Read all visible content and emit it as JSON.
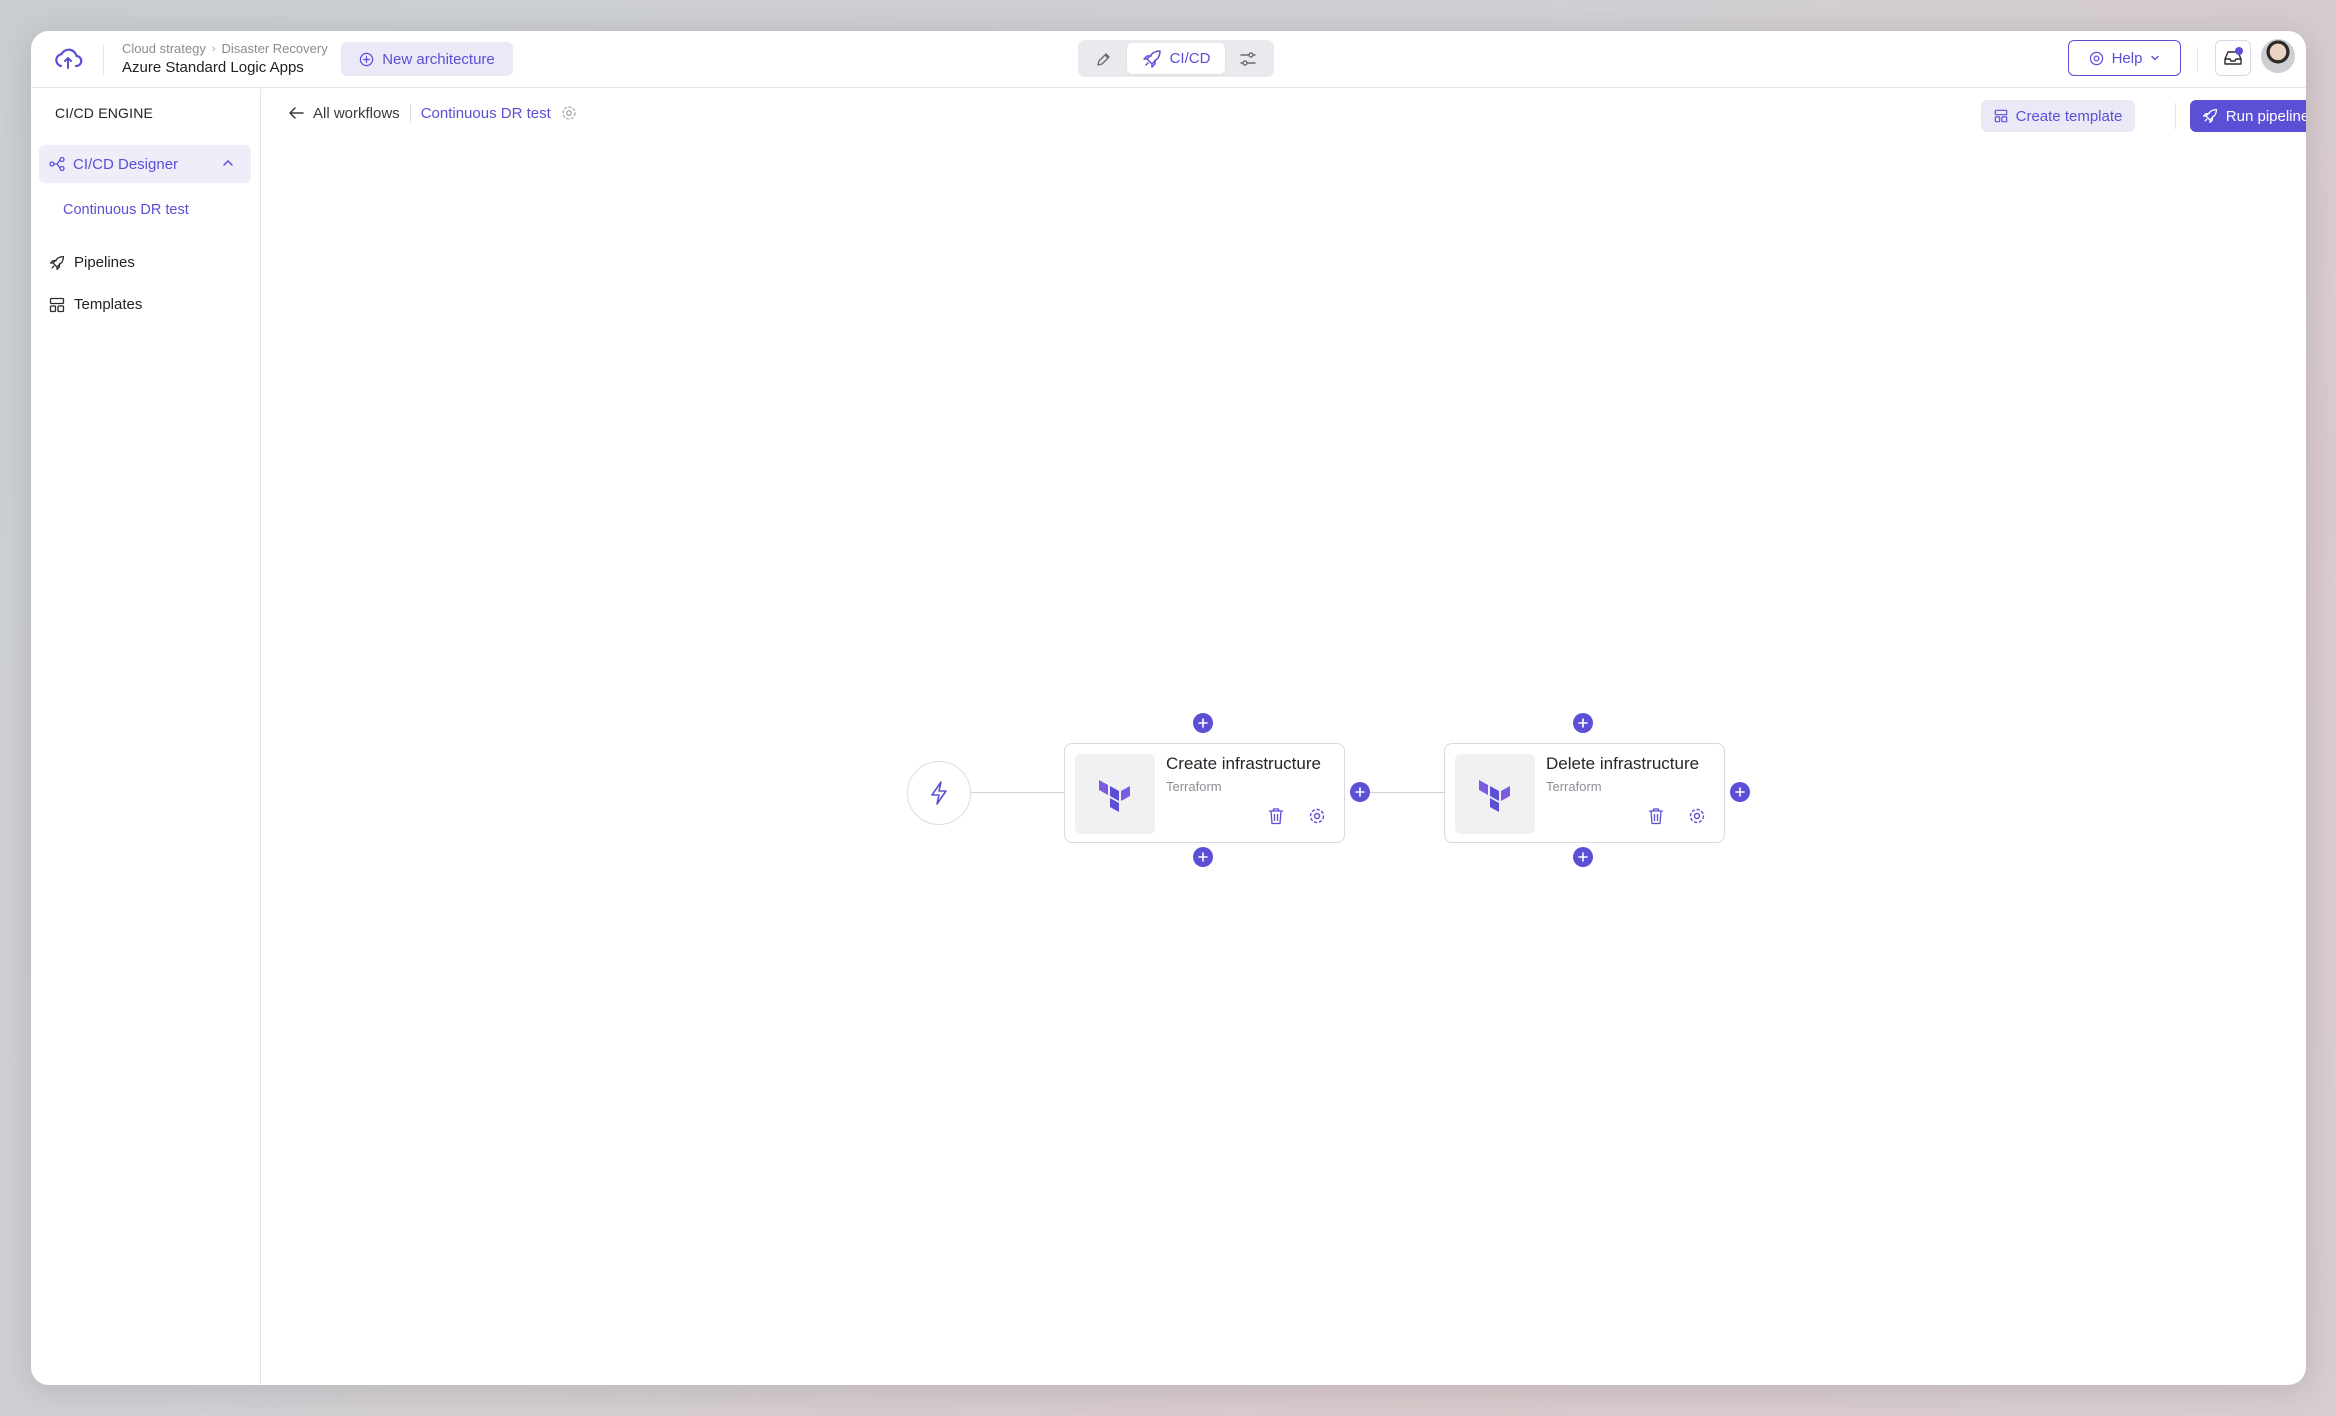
{
  "header": {
    "breadcrumb": [
      "Cloud strategy",
      "Disaster Recovery"
    ],
    "project_title": "Azure Standard Logic Apps",
    "new_architecture_label": "New architecture",
    "modes": [
      {
        "name": "design",
        "icon": "pen-icon",
        "label": ""
      },
      {
        "name": "cicd",
        "icon": "rocket-icon",
        "label": "CI/CD",
        "active": true
      },
      {
        "name": "settings",
        "icon": "sliders-icon",
        "label": ""
      }
    ],
    "help_label": "Help"
  },
  "sidebar": {
    "title": "CI/CD ENGINE",
    "group": {
      "label": "CI/CD Designer",
      "expanded": true,
      "icon": "workflow-icon"
    },
    "sub_items": [
      {
        "label": "Continuous DR test"
      }
    ],
    "items": [
      {
        "label": "Pipelines",
        "icon": "rocket-icon"
      },
      {
        "label": "Templates",
        "icon": "template-icon"
      }
    ]
  },
  "main": {
    "back_label": "All workflows",
    "current_workflow": "Continuous DR test",
    "create_template_label": "Create template",
    "run_pipeline_label": "Run pipeline"
  },
  "workflow": {
    "trigger_icon": "lightning-icon",
    "nodes": [
      {
        "title": "Create infrastructure",
        "provider": "Terraform",
        "icon": "terraform-icon"
      },
      {
        "title": "Delete infrastructure",
        "provider": "Terraform",
        "icon": "terraform-icon"
      }
    ]
  },
  "colors": {
    "accent": "#5b4fd6",
    "accent_light": "#ebe9f8",
    "border": "#d9d9df",
    "text": "#1f1f24"
  }
}
